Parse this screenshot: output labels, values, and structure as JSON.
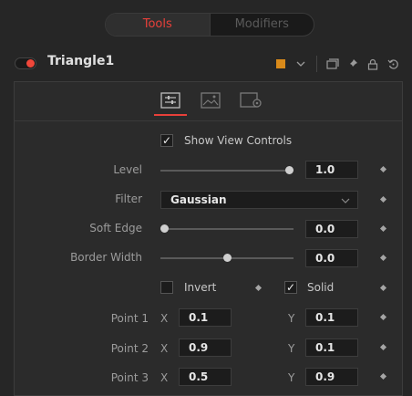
{
  "top_tabs": [
    {
      "label": "Tools",
      "active": true
    },
    {
      "label": "Modifiers",
      "active": false
    }
  ],
  "node": {
    "title": "Triangle1",
    "enabled": true,
    "color_swatch": "#d98a1a"
  },
  "header_icons": [
    "color-swatch",
    "chevron-down-icon",
    "window-icon",
    "pin-icon",
    "lock-icon",
    "reset-icon"
  ],
  "subtabs": [
    {
      "name": "controls",
      "active": true
    },
    {
      "name": "image",
      "active": false
    },
    {
      "name": "settings",
      "active": false
    }
  ],
  "controls": {
    "show_view_controls": {
      "label": "Show View Controls",
      "checked": true
    },
    "level": {
      "label": "Level",
      "value": "1.0",
      "fraction": 1.0
    },
    "filter": {
      "label": "Filter",
      "value": "Gaussian"
    },
    "soft_edge": {
      "label": "Soft Edge",
      "value": "0.0",
      "fraction": 0.0
    },
    "border_width": {
      "label": "Border Width",
      "value": "0.0",
      "fraction": 0.5
    },
    "invert": {
      "label": "Invert",
      "checked": false
    },
    "solid": {
      "label": "Solid",
      "checked": true
    },
    "points": [
      {
        "label": "Point 1",
        "x": "0.1",
        "y": "0.1"
      },
      {
        "label": "Point 2",
        "x": "0.9",
        "y": "0.1"
      },
      {
        "label": "Point 3",
        "x": "0.5",
        "y": "0.9"
      }
    ],
    "x_axis_label": "X",
    "y_axis_label": "Y"
  },
  "colors": {
    "accent": "#e8403a",
    "toggle_on": "#f0473a"
  }
}
